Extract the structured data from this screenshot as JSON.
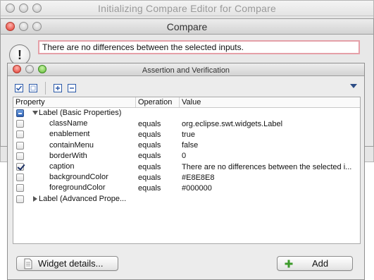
{
  "init_window": {
    "title": "Initializing Compare Editor for Compare"
  },
  "compare_window": {
    "title": "Compare",
    "message": "There are no differences between the selected inputs."
  },
  "assert_window": {
    "title": "Assertion and Verification",
    "columns": {
      "property": "Property",
      "operation": "Operation",
      "value": "Value"
    },
    "rows": [
      {
        "kind": "group",
        "state": "mixed",
        "expanded": true,
        "property": "Label (Basic Properties)",
        "operation": "",
        "value": ""
      },
      {
        "kind": "prop",
        "state": "unchecked",
        "property": "className",
        "operation": "equals",
        "value": "org.eclipse.swt.widgets.Label"
      },
      {
        "kind": "prop",
        "state": "unchecked",
        "property": "enablement",
        "operation": "equals",
        "value": "true"
      },
      {
        "kind": "prop",
        "state": "unchecked",
        "property": "containMenu",
        "operation": "equals",
        "value": "false"
      },
      {
        "kind": "prop",
        "state": "unchecked",
        "property": "borderWith",
        "operation": "equals",
        "value": "0"
      },
      {
        "kind": "prop",
        "state": "checked",
        "property": "caption",
        "operation": "equals",
        "value": "There are no differences between the selected i..."
      },
      {
        "kind": "prop",
        "state": "unchecked",
        "property": "backgroundColor",
        "operation": "equals",
        "value": "#E8E8E8"
      },
      {
        "kind": "prop",
        "state": "unchecked",
        "property": "foregroundColor",
        "operation": "equals",
        "value": "#000000"
      },
      {
        "kind": "group",
        "state": "unchecked",
        "expanded": false,
        "property": "Label (Advanced Prope...",
        "operation": "",
        "value": ""
      }
    ],
    "buttons": {
      "widget_details": "Widget details...",
      "add": "Add"
    },
    "toolbar_icons": [
      "check-all-icon",
      "uncheck-all-icon",
      "expand-all-icon",
      "collapse-all-icon"
    ]
  },
  "colors": {
    "message_border": "#e5a0a8",
    "checkbox_mixed": "#2f62b5",
    "add_icon": "#3c9a2a"
  }
}
